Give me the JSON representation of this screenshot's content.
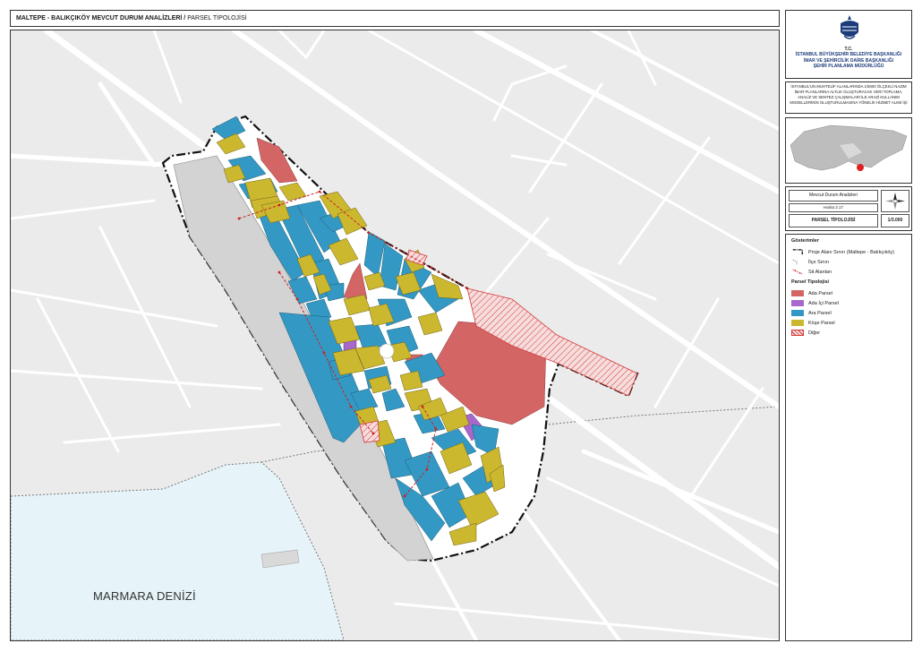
{
  "header": {
    "title_bold": "MALTEPE - BALIKÇIKÖY MEVCUT DURUM ANALİZLERİ /",
    "title_rest": " PARSEL TİPOLOJİSİ"
  },
  "map": {
    "sea_label": "MARMARA DENİZİ"
  },
  "org": {
    "tc": "T.C.",
    "line1": "İSTANBUL BÜYÜKŞEHİR BELEDİYE BAŞKANLIĞI",
    "line2": "İMAR VE ŞEHİRCİLİK DAİRE BAŞKANLIĞI",
    "line3": "ŞEHİR PLANLAMA MÜDÜRLÜĞÜ"
  },
  "project_description": "İSTANBUL'UN MUHTELİF ALANLARINDA 1/5000 ÖLÇEKLİ NAZIM İMAR PLANLARINA ALTLIK OLUŞTURACAK VERİ TOPLAMA, ANALİZ VE SENTEZ ÇALIŞMALARI İLE ARAZİ KULLANIM MODELLERİNİN OLUŞTURULMASINA YÖNELİK HİZMET ALIMI İŞİ",
  "sheet": {
    "analysis": "Mevcut Durum Analizleri",
    "map_no": "Harita 2.17",
    "name": "PARSEL TİPOLOJİSİ",
    "scale": "1/3.000"
  },
  "legend": {
    "title": "Gösterimler",
    "boundary_items": [
      {
        "label": "Proje Alanı Sınırı (Maltepe - Balıkçıköy)",
        "style": "project-boundary"
      },
      {
        "label": "İlçe Sınırı",
        "style": "district-boundary"
      },
      {
        "label": "Sit Alanları",
        "style": "conservation-area"
      }
    ],
    "parcel_title": "Parsel Tipolojisi",
    "parcel_items": [
      {
        "label": "Ada Parsel",
        "color": "#d46565"
      },
      {
        "label": "Ada İçi Parsel",
        "color": "#a867cc"
      },
      {
        "label": "Ara Parsel",
        "color": "#3399c4"
      },
      {
        "label": "Köşe Parsel",
        "color": "#ccb82e"
      },
      {
        "label": "Diğer",
        "color": "#e03c3c",
        "pattern": "hatched"
      }
    ]
  },
  "colors": {
    "ada": "#d46565",
    "ada_ici": "#a867cc",
    "ara": "#3399c4",
    "kose": "#ccb82e",
    "sea": "#e6f4fa",
    "land": "#ebebeb",
    "road": "#ffffff",
    "boundary": "#111111",
    "sit": "#cc2222"
  }
}
